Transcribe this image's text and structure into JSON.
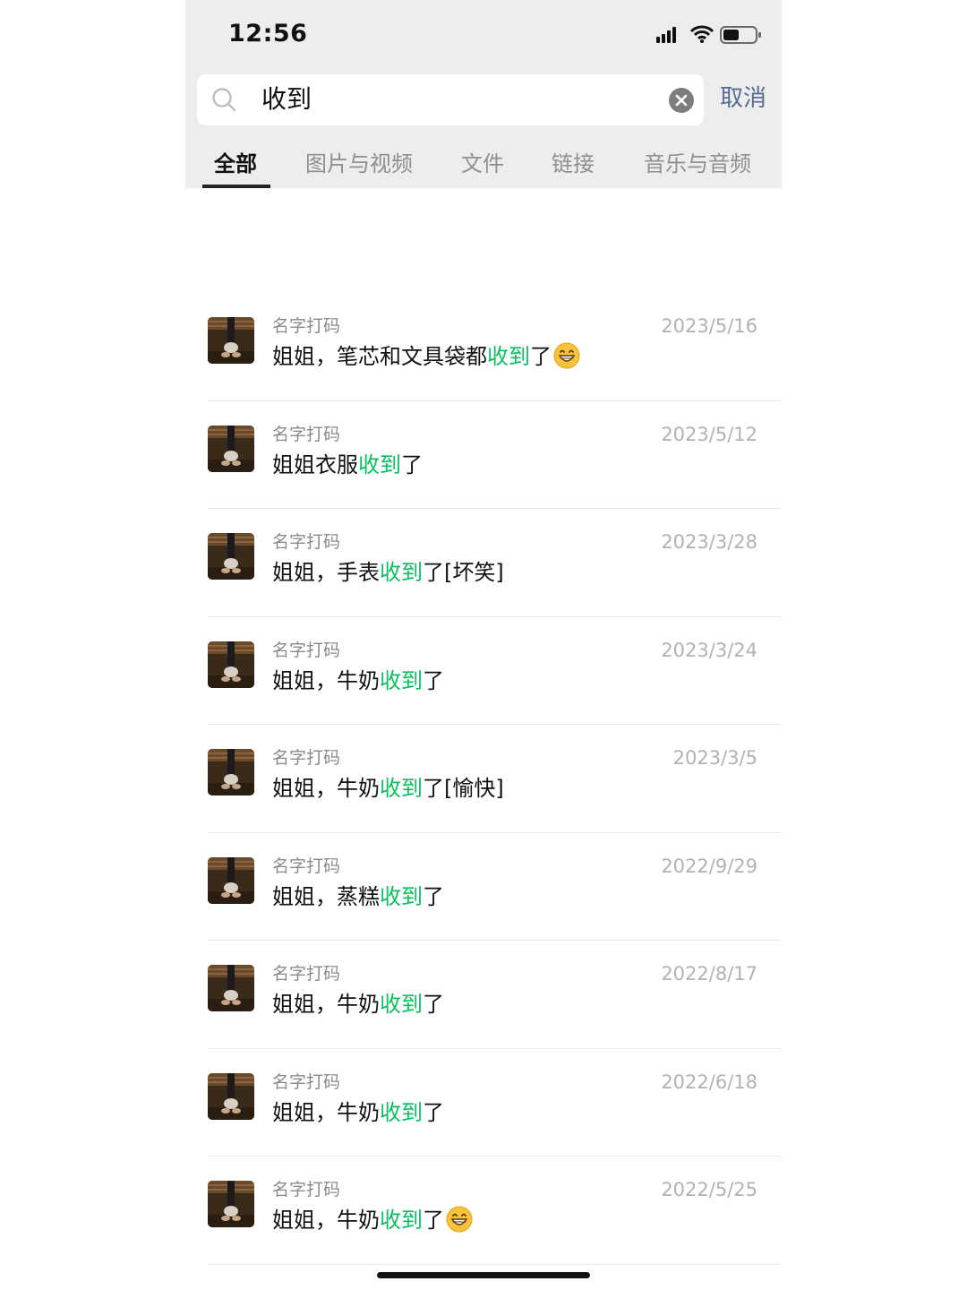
{
  "status_bar": {
    "time": "12:56"
  },
  "search": {
    "query": "收到",
    "cancel_label": "取消"
  },
  "tabs": [
    {
      "label": "全部",
      "active": true
    },
    {
      "label": "图片与视频",
      "active": false
    },
    {
      "label": "文件",
      "active": false
    },
    {
      "label": "链接",
      "active": false
    },
    {
      "label": "音乐与音频",
      "active": false
    }
  ],
  "results": [
    {
      "sender": "名字打码",
      "date": "2023/5/16",
      "before": "姐姐，笔芯和文具袋都",
      "highlight": "收到",
      "after": "了",
      "emoji": "grinning-face-icon"
    },
    {
      "sender": "名字打码",
      "date": "2023/5/12",
      "before": "姐姐衣服",
      "highlight": "收到",
      "after": "了",
      "emoji": ""
    },
    {
      "sender": "名字打码",
      "date": "2023/3/28",
      "before": "姐姐，手表",
      "highlight": "收到",
      "after": "了[坏笑]",
      "emoji": ""
    },
    {
      "sender": "名字打码",
      "date": "2023/3/24",
      "before": "姐姐，牛奶",
      "highlight": "收到",
      "after": "了",
      "emoji": ""
    },
    {
      "sender": "名字打码",
      "date": "2023/3/5",
      "before": "姐姐，牛奶",
      "highlight": "收到",
      "after": "了[愉快]",
      "emoji": ""
    },
    {
      "sender": "名字打码",
      "date": "2022/9/29",
      "before": "姐姐，蒸糕",
      "highlight": "收到",
      "after": "了",
      "emoji": ""
    },
    {
      "sender": "名字打码",
      "date": "2022/8/17",
      "before": "姐姐，牛奶",
      "highlight": "收到",
      "after": "了",
      "emoji": ""
    },
    {
      "sender": "名字打码",
      "date": "2022/6/18",
      "before": "姐姐，牛奶",
      "highlight": "收到",
      "after": "了",
      "emoji": ""
    },
    {
      "sender": "名字打码",
      "date": "2022/5/25",
      "before": "姐姐，牛奶",
      "highlight": "收到",
      "after": "了",
      "emoji": "grinning-face-icon"
    }
  ],
  "colors": {
    "highlight": "#07c160",
    "link": "#576b95",
    "top_background": "#ededed"
  }
}
